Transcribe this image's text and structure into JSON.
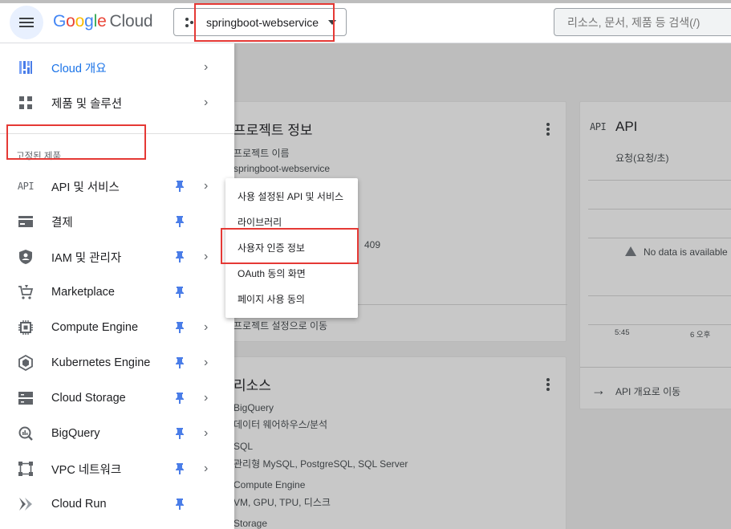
{
  "topbar": {
    "logo_letters": [
      "G",
      "o",
      "o",
      "g",
      "l",
      "e"
    ],
    "logo_suffix": "Cloud",
    "project_name": "springboot-webservice",
    "search_placeholder": "리소스, 문서, 제품 등 검색(/)"
  },
  "drawer": {
    "top_items": [
      {
        "label": "Cloud 개요",
        "icon": "dashboard-icon"
      },
      {
        "label": "제품 및 솔루션",
        "icon": "grid-icon"
      }
    ],
    "pinned_section_label": "고정된 제품",
    "pinned_items": [
      {
        "label": "API 및 서비스",
        "icon_text": "API",
        "chevron": true
      },
      {
        "label": "결제",
        "icon": "billing-icon",
        "chevron": false
      },
      {
        "label": "IAM 및 관리자",
        "icon": "shield-icon",
        "chevron": true
      },
      {
        "label": "Marketplace",
        "icon": "cart-icon",
        "chevron": false
      },
      {
        "label": "Compute Engine",
        "icon": "chip-icon",
        "chevron": true
      },
      {
        "label": "Kubernetes Engine",
        "icon": "hexagon-icon",
        "chevron": true
      },
      {
        "label": "Cloud Storage",
        "icon": "storage-icon",
        "chevron": true
      },
      {
        "label": "BigQuery",
        "icon": "bigquery-icon",
        "chevron": true
      },
      {
        "label": "VPC 네트워크",
        "icon": "network-icon",
        "chevron": true
      },
      {
        "label": "Cloud Run",
        "icon": "run-icon",
        "chevron": false
      }
    ]
  },
  "submenu": {
    "items": [
      "사용 설정된 API 및 서비스",
      "라이브러리",
      "사용자 인증 정보",
      "OAuth 동의 화면",
      "페이지 사용 동의"
    ]
  },
  "project_card": {
    "title": "프로젝트 정보",
    "name_label": "프로젝트 이름",
    "name_value": "springboot-webservice",
    "number_fragment": "409",
    "link": "프로젝트 설정으로 이동"
  },
  "resources_card": {
    "title": "리소스",
    "items": [
      {
        "name": "BigQuery",
        "desc": "데이터 웨어하우스/분석"
      },
      {
        "name": "SQL",
        "desc": "관리형 MySQL, PostgreSQL, SQL Server"
      },
      {
        "name": "Compute Engine",
        "desc": "VM, GPU, TPU, 디스크"
      },
      {
        "name": "Storage",
        "desc": ""
      }
    ]
  },
  "api_card": {
    "icon_text": "API",
    "title": "API",
    "metric": "요청(요청/초)",
    "no_data": "No data is available",
    "x_ticks": [
      "5:45",
      "6 오후"
    ],
    "link": "API 개요로 이동"
  },
  "colors": {
    "accent_blue": "#1a73e8",
    "highlight_red": "#e53935",
    "pin_blue": "#4a7de8"
  }
}
